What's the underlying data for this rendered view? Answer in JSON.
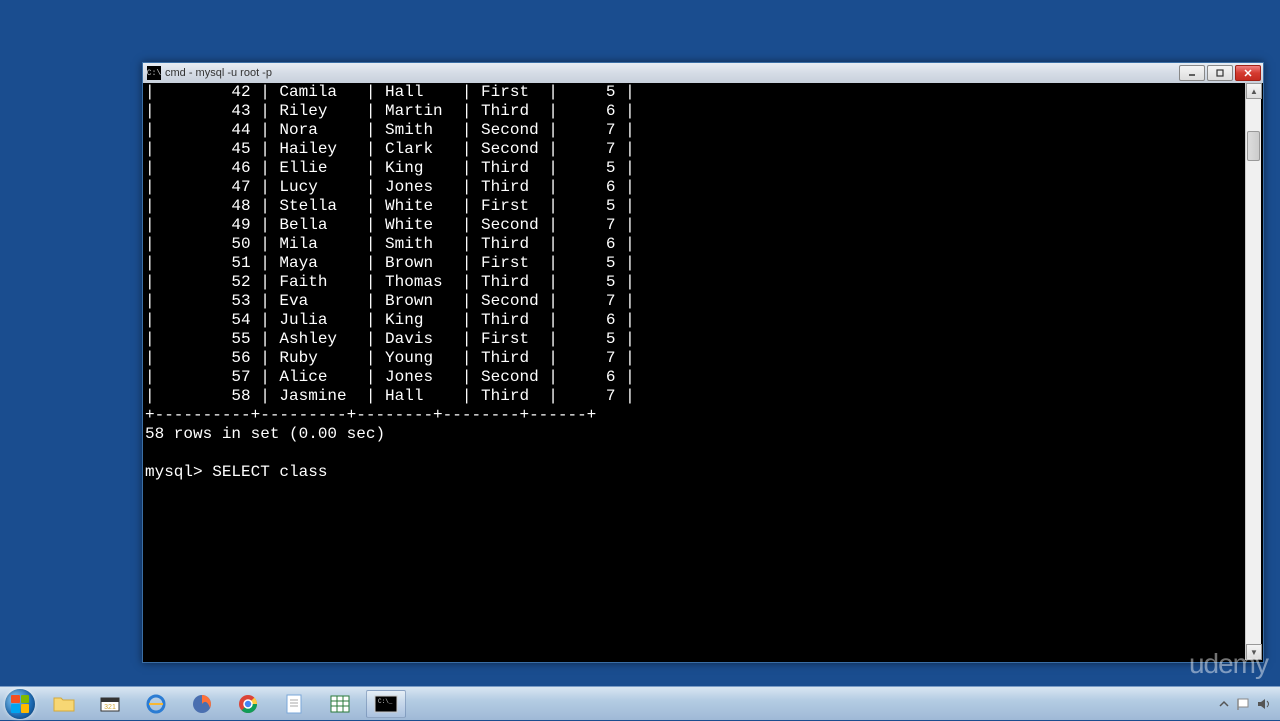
{
  "window": {
    "title": "cmd - mysql  -u root -p"
  },
  "table": {
    "rows": [
      {
        "id": 42,
        "first": "Camila",
        "last": "Hall",
        "class": "First",
        "num": 5
      },
      {
        "id": 43,
        "first": "Riley",
        "last": "Martin",
        "class": "Third",
        "num": 6
      },
      {
        "id": 44,
        "first": "Nora",
        "last": "Smith",
        "class": "Second",
        "num": 7
      },
      {
        "id": 45,
        "first": "Hailey",
        "last": "Clark",
        "class": "Second",
        "num": 7
      },
      {
        "id": 46,
        "first": "Ellie",
        "last": "King",
        "class": "Third",
        "num": 5
      },
      {
        "id": 47,
        "first": "Lucy",
        "last": "Jones",
        "class": "Third",
        "num": 6
      },
      {
        "id": 48,
        "first": "Stella",
        "last": "White",
        "class": "First",
        "num": 5
      },
      {
        "id": 49,
        "first": "Bella",
        "last": "White",
        "class": "Second",
        "num": 7
      },
      {
        "id": 50,
        "first": "Mila",
        "last": "Smith",
        "class": "Third",
        "num": 6
      },
      {
        "id": 51,
        "first": "Maya",
        "last": "Brown",
        "class": "First",
        "num": 5
      },
      {
        "id": 52,
        "first": "Faith",
        "last": "Thomas",
        "class": "Third",
        "num": 5
      },
      {
        "id": 53,
        "first": "Eva",
        "last": "Brown",
        "class": "Second",
        "num": 7
      },
      {
        "id": 54,
        "first": "Julia",
        "last": "King",
        "class": "Third",
        "num": 6
      },
      {
        "id": 55,
        "first": "Ashley",
        "last": "Davis",
        "class": "First",
        "num": 5
      },
      {
        "id": 56,
        "first": "Ruby",
        "last": "Young",
        "class": "Third",
        "num": 7
      },
      {
        "id": 57,
        "first": "Alice",
        "last": "Jones",
        "class": "Second",
        "num": 6
      },
      {
        "id": 58,
        "first": "Jasmine",
        "last": "Hall",
        "class": "Third",
        "num": 7
      }
    ],
    "col_widths": {
      "id": 10,
      "first": 9,
      "last": 8,
      "class": 7,
      "num": 6
    },
    "separator": "+----------+---------+--------+--------+------+",
    "footer": "58 rows in set (0.00 sec)"
  },
  "prompt": {
    "label": "mysql>",
    "command": "SELECT class"
  },
  "watermark": "udemy"
}
